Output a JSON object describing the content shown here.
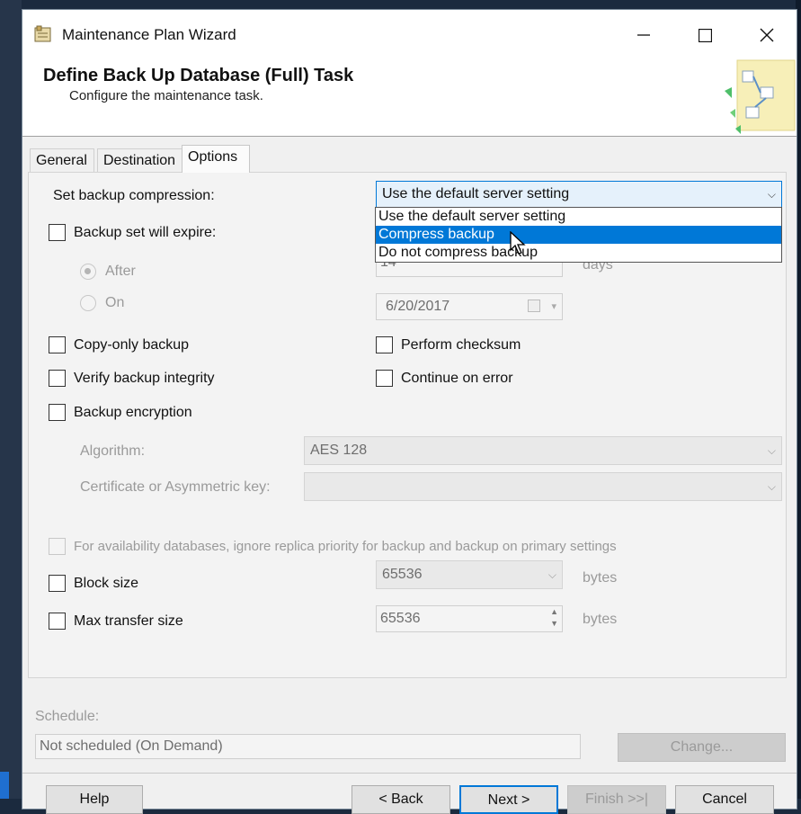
{
  "window": {
    "title": "Maintenance Plan Wizard"
  },
  "header": {
    "title": "Define Back Up Database (Full) Task",
    "subtitle": "Configure the maintenance task."
  },
  "tabs": [
    {
      "label": "General",
      "active": false
    },
    {
      "label": "Destination",
      "active": false
    },
    {
      "label": "Options",
      "active": true
    }
  ],
  "compression": {
    "label": "Set backup compression:",
    "selected": "Use the default server setting",
    "options": [
      "Use the default server setting",
      "Compress backup",
      "Do not compress backup"
    ],
    "highlighted": "Compress backup"
  },
  "expire": {
    "label": "Backup set will expire:",
    "checked": false,
    "after_label": "After",
    "after_value": "14",
    "after_unit": "days",
    "on_label": "On",
    "on_value": "6/20/2017"
  },
  "checkboxes": {
    "copy_only": "Copy-only backup",
    "checksum": "Perform checksum",
    "verify": "Verify backup integrity",
    "continue_on_error": "Continue on error",
    "encryption": "Backup encryption",
    "availability": "For availability databases, ignore replica priority for backup and backup on primary settings",
    "block_size": "Block size",
    "max_transfer": "Max transfer size"
  },
  "encryption": {
    "algorithm_label": "Algorithm:",
    "algorithm_value": "AES 128",
    "cert_label": "Certificate or Asymmetric key:",
    "cert_value": ""
  },
  "block_size": {
    "value": "65536",
    "unit": "bytes"
  },
  "max_transfer": {
    "value": "65536",
    "unit": "bytes"
  },
  "schedule": {
    "label": "Schedule:",
    "value": "Not scheduled (On Demand)",
    "change_label": "Change..."
  },
  "footer": {
    "help": "Help",
    "back": "< Back",
    "next": "Next >",
    "finish": "Finish >>|",
    "cancel": "Cancel"
  }
}
